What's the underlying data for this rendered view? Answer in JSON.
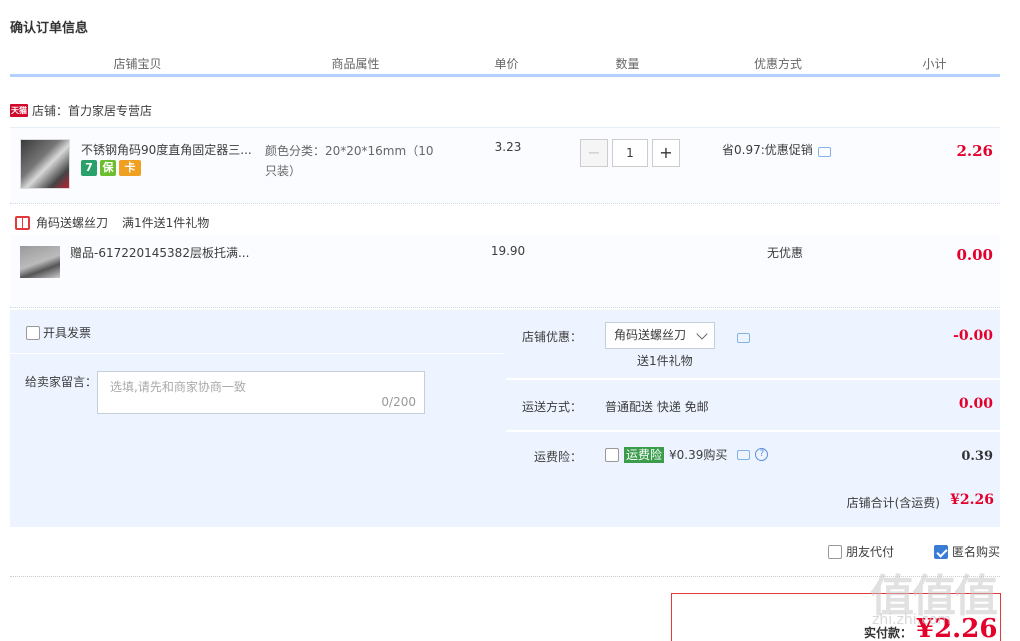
{
  "page": {
    "title": "确认订单信息"
  },
  "columns": [
    "店铺宝贝",
    "商品属性",
    "单价",
    "数量",
    "优惠方式",
    "小计"
  ],
  "shop": {
    "badge": "天猫",
    "label": "店铺：首力家居专营店"
  },
  "item": {
    "name": "不锈钢角码90度直角固定器三...",
    "badges": [
      "7",
      "保",
      "卡"
    ],
    "sku": "颜色分类：20*20*16mm（10只装）",
    "unit_price": "3.23",
    "quantity": "1",
    "minus": "−",
    "plus": "+",
    "promo": "省0.97:优惠促销",
    "subtotal": "2.26"
  },
  "gift_header": {
    "name": "角码送螺丝刀",
    "rule": "满1件送1件礼物"
  },
  "gift": {
    "name": "赠品-617220145382层板托满...",
    "unit_price": "19.90",
    "promo": "无优惠",
    "subtotal": "0.00"
  },
  "invoice": {
    "label": "开具发票"
  },
  "message": {
    "label": "给卖家留言：",
    "placeholder": "选填,请先和商家协商一致",
    "counter": "0/200"
  },
  "shop_discount": {
    "label": "店铺优惠：",
    "selected": "角码送螺丝刀",
    "sub": "送1件礼物",
    "value": "-0.00"
  },
  "shipping": {
    "label": "运送方式：",
    "method": "普通配送 快递 免邮",
    "value": "0.00"
  },
  "insurance": {
    "label": "运费险：",
    "tag": "运费险",
    "price": "¥0.39购买",
    "help": "?",
    "value": "0.39"
  },
  "shop_total": {
    "label": "店铺合计(含运费)",
    "value": "¥2.26"
  },
  "options": {
    "friend_pay": "朋友代付",
    "anonymous": "匿名购买"
  },
  "payment": {
    "label": "实付款：",
    "value": "¥2.26"
  },
  "watermark": {
    "main": "值值值",
    "sub": "zhi.zhi.com"
  }
}
